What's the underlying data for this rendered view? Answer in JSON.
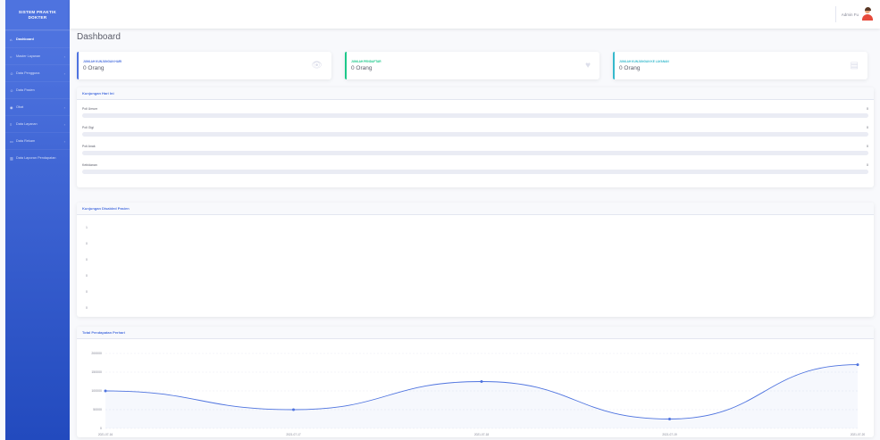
{
  "app": {
    "brand_line1": "SISTEM PRAKTIK",
    "brand_line2": "DOKTER"
  },
  "sidebar": {
    "items": [
      {
        "label": "Dashboard",
        "icon": "home-icon",
        "active": true,
        "chevron": false
      },
      {
        "label": "Master Layanan",
        "icon": "circle-icon",
        "active": false,
        "chevron": true
      },
      {
        "label": "Data Pengguna",
        "icon": "user-icon",
        "active": false,
        "chevron": true
      },
      {
        "label": "Data Pasien",
        "icon": "user-icon",
        "active": false,
        "chevron": false
      },
      {
        "label": "Obat",
        "icon": "pill-icon",
        "active": false,
        "chevron": true
      },
      {
        "label": "Data Layanan",
        "icon": "list-icon",
        "active": false,
        "chevron": true
      },
      {
        "label": "Data Rekam",
        "icon": "file-icon",
        "active": false,
        "chevron": true
      },
      {
        "label": "Data Laporan Pendapatan",
        "icon": "chart-icon",
        "active": false,
        "chevron": false
      }
    ]
  },
  "topbar": {
    "user_name": "Admin Fu"
  },
  "page": {
    "title": "Dashboard"
  },
  "stats": [
    {
      "label": "Jumlah Kunjungan Hari",
      "value": "0 Orang",
      "color": "#4e73df",
      "icon": "eye-icon"
    },
    {
      "label": "Jumlah Pendaftar",
      "value": "0 Orang",
      "color": "#1cc88a",
      "icon": "heart-icon"
    },
    {
      "label": "Jumlah Kunjungan ke Layanan",
      "value": "0 Orang",
      "color": "#36b9cc",
      "icon": "clipboard-icon"
    }
  ],
  "visits_card": {
    "title": "Kunjungan Hari Ini",
    "rows": [
      {
        "name": "Poli Umum",
        "value": "0",
        "fraction": 0
      },
      {
        "name": "Poli Gigi",
        "value": "0",
        "fraction": 0
      },
      {
        "name": "Poli Anak",
        "value": "0",
        "fraction": 0
      },
      {
        "name": "Kebidanan",
        "value": "0",
        "fraction": 0
      }
    ]
  },
  "monthly_card": {
    "title": "Kunjungan Disabled Pasien",
    "yticks": [
      "1",
      "0",
      "0",
      "0",
      "0",
      "0"
    ]
  },
  "income_card": {
    "title": "Total Pendapatan Perhari"
  },
  "chart_data": {
    "type": "area",
    "title": "Total Pendapatan Perhari",
    "x": [
      "2021-07-16",
      "2021-07-17",
      "2021-07-18",
      "2021-07-19",
      "2021-07-20"
    ],
    "values": [
      100000,
      50000,
      125000,
      25000,
      170000
    ],
    "ylim": [
      0,
      200000
    ],
    "yticks": [
      "0",
      "50000",
      "100000",
      "150000",
      "200000"
    ],
    "color": "#4e73df",
    "fill": "rgba(78,115,223,0.05)",
    "grid": true
  }
}
